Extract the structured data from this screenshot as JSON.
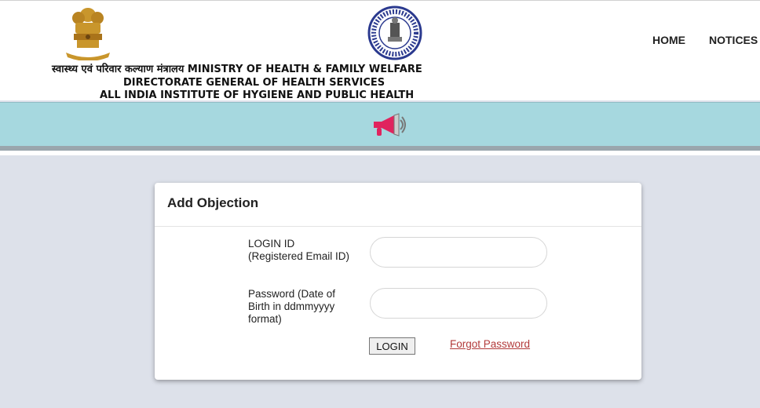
{
  "header": {
    "ministry_title": "स्वास्थ्य एवं परिवार कल्याण मंत्रालय MINISTRY OF HEALTH & FAMILY WELFARE",
    "directorate": "DIRECTORATE GENERAL OF HEALTH SERVICES",
    "institute": "ALL INDIA INSTITUTE OF HYGIENE AND PUBLIC HEALTH"
  },
  "nav": {
    "home": "HOME",
    "notices": "NOTICES"
  },
  "icons": {
    "emblem": "national-emblem-icon",
    "seal": "institute-seal-icon",
    "announcement": "megaphone-icon"
  },
  "colors": {
    "banner": "#a6d8df",
    "background": "#dde1ea",
    "link": "#b23a3a"
  },
  "form": {
    "title": "Add Objection",
    "login_label": "LOGIN ID (Registered Email ID)",
    "login_value": "",
    "password_label": "Password (Date of Birth in ddmmyyyy format)",
    "password_value": "",
    "login_button": "LOGIN",
    "forgot_link": "Forgot Password"
  }
}
